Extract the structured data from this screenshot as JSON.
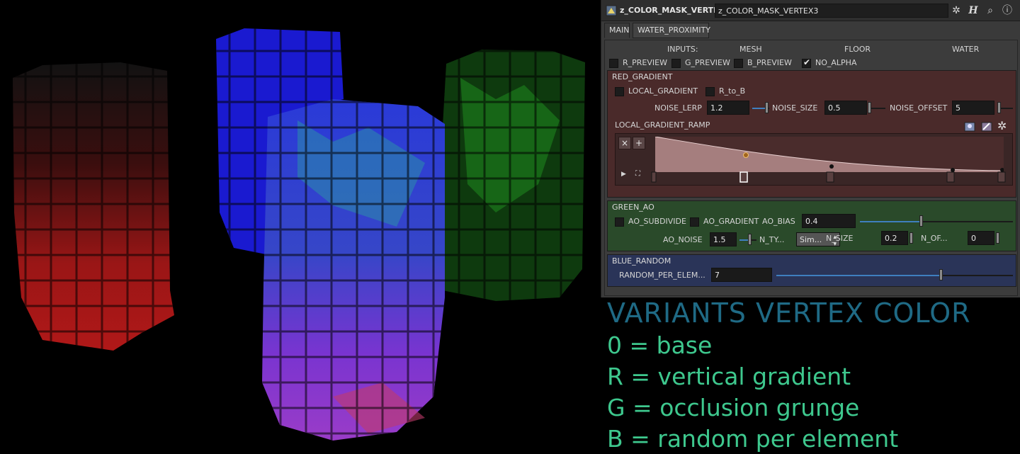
{
  "header": {
    "node_type": "z_COLOR_MASK_VERTEX",
    "node_name": "z_COLOR_MASK_VERTEX3",
    "icons": [
      "gear-icon",
      "help-h-icon",
      "search-icon",
      "info-icon"
    ]
  },
  "tabs": [
    {
      "label": "MAIN",
      "active": true
    },
    {
      "label": "WATER_PROXIMITY",
      "active": false
    }
  ],
  "inputs": {
    "label": "INPUTS:",
    "mesh": "MESH",
    "floor": "FLOOR",
    "water": "WATER"
  },
  "previews": [
    {
      "label": "R_PREVIEW",
      "checked": false
    },
    {
      "label": "G_PREVIEW",
      "checked": false
    },
    {
      "label": "B_PREVIEW",
      "checked": false
    },
    {
      "label": "NO_ALPHA",
      "checked": true
    }
  ],
  "red_gradient": {
    "title": "RED_GRADIENT",
    "color": "#4a2a2a",
    "local_gradient_label": "LOCAL_GRADIENT",
    "r_to_b_label": "R_to_B",
    "noise_lerp_label": "NOISE_LERP",
    "noise_lerp_value": "1.2",
    "noise_size_label": "NOISE_SIZE",
    "noise_size_value": "0.5",
    "noise_offset_label": "NOISE_OFFSET",
    "noise_offset_value": "5",
    "ramp_label": "LOCAL_GRADIENT_RAMP",
    "ramp_buttons": {
      "remove": "×",
      "add": "+"
    }
  },
  "green_ao": {
    "title": "GREEN_AO",
    "color": "#2a4a2a",
    "ao_subdivide_label": "AO_SUBDIVIDE",
    "ao_gradient_label": "AO_GRADIENT",
    "ao_bias_label": "AO_BIAS",
    "ao_bias_value": "0.4",
    "ao_noise_label": "AO_NOISE",
    "ao_noise_value": "1.5",
    "n_type_label": "N_TY...",
    "n_type_value": "Sim...",
    "n_size_label": "N_SIZE",
    "n_size_value": "0.2",
    "n_offset_label": "N_OF...",
    "n_offset_value": "0"
  },
  "blue_random": {
    "title": "BLUE_RANDOM",
    "color": "#2a3458",
    "random_label": "RANDOM_PER_ELEM...",
    "random_value": "7"
  },
  "overlay": {
    "title": "VARIANTS VERTEX COLOR",
    "lines": [
      "0 = base",
      "R = vertical gradient",
      "G = occlusion grunge",
      "B = random per element"
    ]
  }
}
